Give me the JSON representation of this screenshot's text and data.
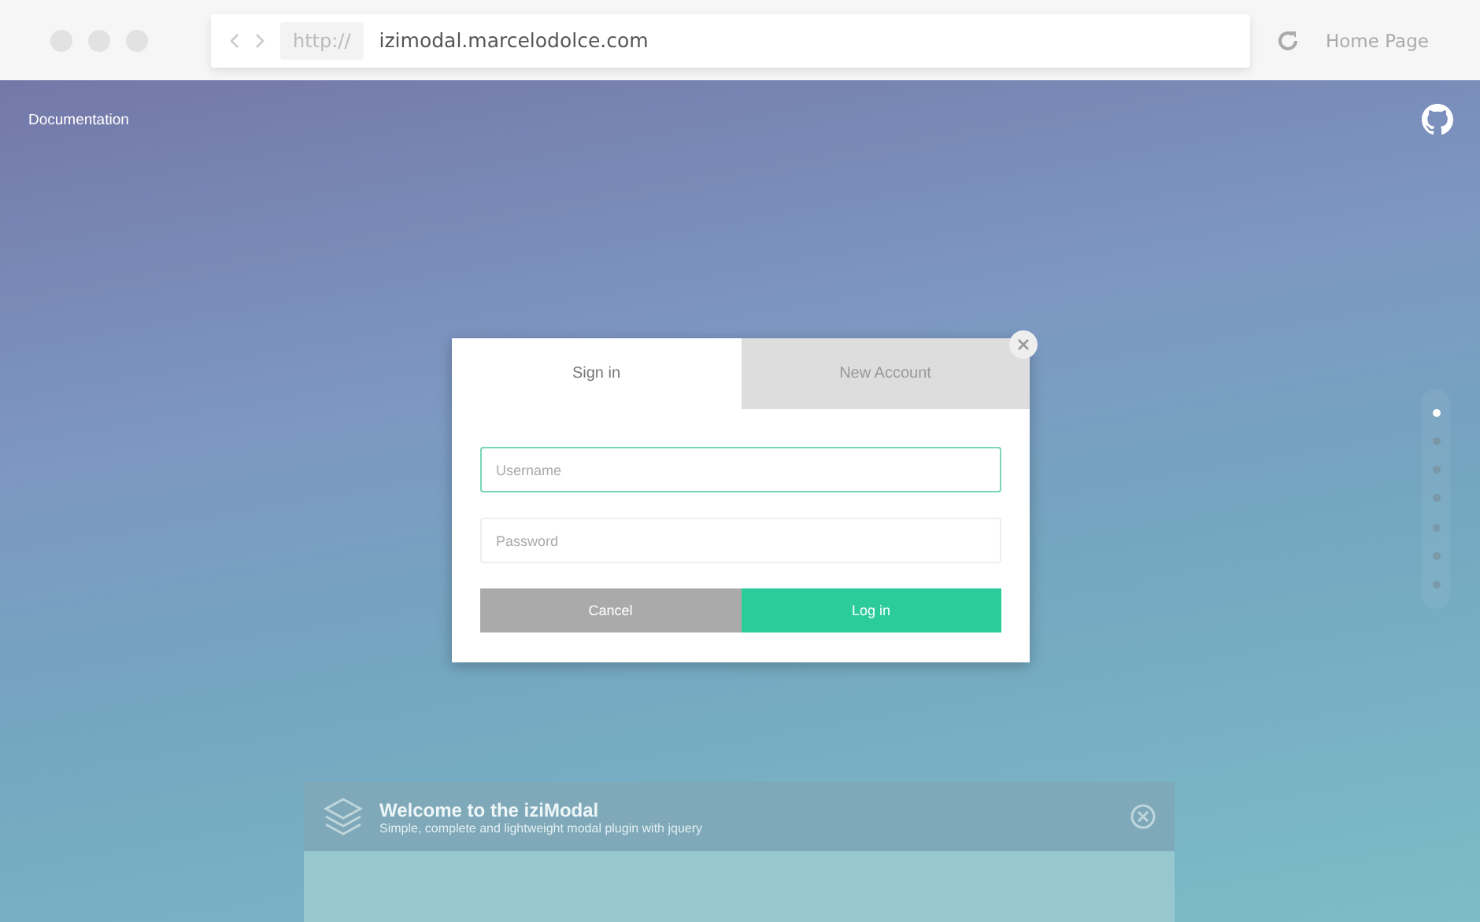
{
  "browser": {
    "protocol": "http://",
    "address": "izimodal.marcelodolce.com",
    "home_link": "Home Page"
  },
  "page": {
    "nav_link": "Documentation"
  },
  "background_modal": {
    "title": "Welcome to the iziModal",
    "subtitle": "Simple, complete and lightweight modal plugin with jquery"
  },
  "dots": [
    {
      "selected": true
    },
    {
      "selected": false
    },
    {
      "selected": false
    },
    {
      "selected": false
    },
    {
      "selected": false
    },
    {
      "selected": false
    },
    {
      "selected": false
    }
  ],
  "modal": {
    "tabs": [
      {
        "label": "Sign in",
        "selected": true
      },
      {
        "label": "New Account",
        "selected": false
      }
    ],
    "fields": [
      {
        "placeholder": "Username",
        "focused": true
      },
      {
        "placeholder": "Password",
        "focused": false
      }
    ],
    "buttons": [
      {
        "label": "Cancel",
        "kind": "secondary"
      },
      {
        "label": "Log in",
        "kind": "primary"
      }
    ]
  }
}
